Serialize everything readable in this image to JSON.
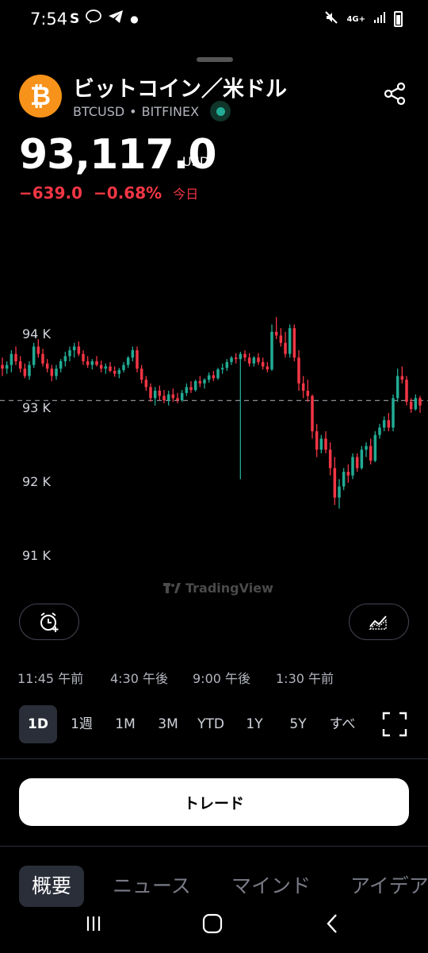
{
  "status": {
    "time": "7:54",
    "left_icons": [
      "s-app-icon",
      "line-icon",
      "telegram-icon",
      "dot-icon"
    ],
    "network": "4G+",
    "right_icons": [
      "mute-icon",
      "network-4g-icon",
      "signal-icon",
      "battery-icon"
    ]
  },
  "header": {
    "title": "ビットコイン／米ドル",
    "symbol": "BTCUSD",
    "separator": "•",
    "exchange": "BITFINEX"
  },
  "quote": {
    "price": "93,117.0",
    "unit": "USD",
    "change": "−639.0",
    "change_percent": "−0.68%",
    "period": "今日"
  },
  "colors": {
    "up": "#22ab94",
    "down": "#f23645",
    "brand_btc": "#f7931a"
  },
  "chart_data": {
    "type": "candlestick",
    "y_ticks": [
      "94 K",
      "93 K",
      "92 K",
      "91 K"
    ],
    "y_tick_values": [
      94000,
      93000,
      92000,
      91000
    ],
    "ylim": [
      90900,
      94350
    ],
    "reference_line": 93117,
    "x_ticks": [
      "11:45 午前",
      "4:30 午後",
      "9:00 午後",
      "1:30 午前"
    ],
    "candles": [
      [
        93600,
        93700,
        93450,
        93550
      ],
      [
        93550,
        93650,
        93480,
        93600
      ],
      [
        93600,
        93800,
        93500,
        93750
      ],
      [
        93750,
        93850,
        93600,
        93650
      ],
      [
        93650,
        93720,
        93500,
        93550
      ],
      [
        93550,
        93620,
        93420,
        93450
      ],
      [
        93450,
        93650,
        93400,
        93600
      ],
      [
        93600,
        93900,
        93560,
        93850
      ],
      [
        93850,
        93950,
        93700,
        93750
      ],
      [
        93750,
        93820,
        93580,
        93620
      ],
      [
        93620,
        93680,
        93500,
        93550
      ],
      [
        93550,
        93600,
        93380,
        93450
      ],
      [
        93450,
        93600,
        93400,
        93550
      ],
      [
        93550,
        93680,
        93500,
        93650
      ],
      [
        93650,
        93780,
        93580,
        93720
      ],
      [
        93720,
        93850,
        93650,
        93800
      ],
      [
        93800,
        93900,
        93700,
        93850
      ],
      [
        93850,
        93920,
        93720,
        93750
      ],
      [
        93750,
        93800,
        93600,
        93650
      ],
      [
        93650,
        93720,
        93560,
        93600
      ],
      [
        93600,
        93680,
        93540,
        93650
      ],
      [
        93650,
        93720,
        93580,
        93600
      ],
      [
        93600,
        93660,
        93500,
        93550
      ],
      [
        93550,
        93620,
        93480,
        93580
      ],
      [
        93580,
        93640,
        93500,
        93520
      ],
      [
        93520,
        93580,
        93440,
        93480
      ],
      [
        93480,
        93560,
        93420,
        93530
      ],
      [
        93530,
        93640,
        93500,
        93600
      ],
      [
        93600,
        93720,
        93560,
        93700
      ],
      [
        93700,
        93850,
        93650,
        93800
      ],
      [
        93800,
        93850,
        93500,
        93550
      ],
      [
        93550,
        93600,
        93350,
        93400
      ],
      [
        93400,
        93450,
        93250,
        93300
      ],
      [
        93300,
        93350,
        93100,
        93150
      ],
      [
        93150,
        93300,
        93050,
        93250
      ],
      [
        93250,
        93320,
        93120,
        93180
      ],
      [
        93180,
        93260,
        93080,
        93120
      ],
      [
        93120,
        93250,
        93050,
        93200
      ],
      [
        93200,
        93280,
        93100,
        93150
      ],
      [
        93150,
        93220,
        93080,
        93120
      ],
      [
        93120,
        93260,
        93100,
        93220
      ],
      [
        93220,
        93350,
        93180,
        93300
      ],
      [
        93300,
        93380,
        93220,
        93260
      ],
      [
        93260,
        93400,
        93240,
        93380
      ],
      [
        93380,
        93450,
        93300,
        93350
      ],
      [
        93350,
        93420,
        93280,
        93400
      ],
      [
        93400,
        93500,
        93360,
        93460
      ],
      [
        93460,
        93520,
        93380,
        93420
      ],
      [
        93420,
        93560,
        93400,
        93540
      ],
      [
        93540,
        93620,
        93480,
        93560
      ],
      [
        93560,
        93680,
        93520,
        93640
      ],
      [
        93640,
        93720,
        93600,
        93700
      ],
      [
        93700,
        93760,
        93620,
        93680
      ],
      [
        93680,
        93780,
        92050,
        93750
      ],
      [
        93750,
        93800,
        93650,
        93700
      ],
      [
        93700,
        93760,
        93580,
        93620
      ],
      [
        93620,
        93720,
        93580,
        93700
      ],
      [
        93700,
        93760,
        93600,
        93640
      ],
      [
        93640,
        93700,
        93540,
        93580
      ],
      [
        93580,
        93640,
        93500,
        93540
      ],
      [
        93540,
        94150,
        93520,
        94050
      ],
      [
        94050,
        94250,
        93950,
        94000
      ],
      [
        94000,
        94100,
        93850,
        93900
      ],
      [
        93900,
        94050,
        93700,
        93750
      ],
      [
        93750,
        94150,
        93700,
        94100
      ],
      [
        94100,
        94150,
        93650,
        93700
      ],
      [
        93700,
        93800,
        93250,
        93350
      ],
      [
        93350,
        93450,
        93150,
        93250
      ],
      [
        93250,
        93400,
        93100,
        93180
      ],
      [
        93180,
        93200,
        92600,
        92700
      ],
      [
        92700,
        92800,
        92350,
        92450
      ],
      [
        92450,
        92650,
        92400,
        92600
      ],
      [
        92600,
        92700,
        92400,
        92450
      ],
      [
        92450,
        92550,
        92100,
        92200
      ],
      [
        92200,
        92350,
        91700,
        91800
      ],
      [
        91800,
        92050,
        91650,
        91950
      ],
      [
        91950,
        92200,
        91900,
        92150
      ],
      [
        92150,
        92250,
        92000,
        92100
      ],
      [
        92100,
        92400,
        92050,
        92350
      ],
      [
        92350,
        92400,
        92150,
        92200
      ],
      [
        92200,
        92500,
        92180,
        92450
      ],
      [
        92450,
        92550,
        92350,
        92500
      ],
      [
        92500,
        92600,
        92250,
        92300
      ],
      [
        92300,
        92700,
        92280,
        92650
      ],
      [
        92650,
        92800,
        92600,
        92750
      ],
      [
        92750,
        92900,
        92700,
        92850
      ],
      [
        92850,
        92950,
        92700,
        92750
      ],
      [
        92750,
        93200,
        92700,
        93150
      ],
      [
        93150,
        93550,
        93100,
        93450
      ],
      [
        93450,
        93580,
        93350,
        93400
      ],
      [
        93400,
        93450,
        93050,
        93100
      ],
      [
        93100,
        93150,
        92950,
        93000
      ],
      [
        93000,
        93200,
        92980,
        93150
      ],
      [
        93150,
        93180,
        92950,
        93050
      ]
    ]
  },
  "watermark": "TradingView",
  "ranges": [
    "1D",
    "1週",
    "1M",
    "3M",
    "YTD",
    "1Y",
    "5Y",
    "すべ"
  ],
  "active_range": "1D",
  "trade_label": "トレード",
  "tabs": [
    "概要",
    "ニュース",
    "マインド",
    "アイデア"
  ],
  "active_tab": "概要"
}
